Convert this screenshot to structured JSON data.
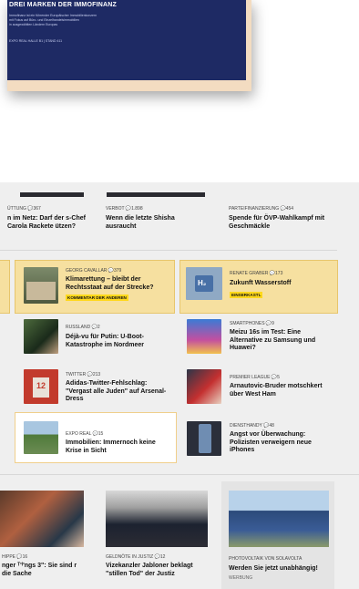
{
  "poster": {
    "title": "DREI MARKEN DER IMMOFINANZ",
    "line1": "Immofinanz ist ein führender Europäischer Immobilienkonzern",
    "line2": "mit Fokus auf Büro- und Einzelhandelsimmobilien",
    "line3": "in ausgewählten Ländern Europas",
    "stand": "EXPO REAL HALLE B1 | STAND 411"
  },
  "colors": {
    "accent_yellow": "#ffd81b",
    "card_yellow": "#f6e0a0",
    "poster_blue": "#1e2a64"
  },
  "row1": [
    {
      "meta": "ÜTTUNG 💬367",
      "headline": "n im Netz: Darf der s-Chef Carola Rackete ützen?"
    },
    {
      "meta": "VERBOT 💬1.898",
      "headline": "Wenn die letzte Shisha ausraucht"
    },
    {
      "meta": "PARTEIFINANZIERUNG 💬454",
      "headline": "Spende für ÖVP-Wahlkampf mit Geschmäckle"
    }
  ],
  "cards": [
    {
      "meta": "GEORG CAVALLAR 💬379",
      "headline": "Klimarettung – bleibt der Rechtsstaat auf der Strecke?",
      "tag": "KOMMENTAR DER ANDEREN"
    },
    {
      "meta": "RENATE GRABER 💬173",
      "headline": "Zukunft Wasserstoff",
      "tag": "EINSERKASTL",
      "icon_text": "H₂"
    }
  ],
  "list": [
    {
      "meta": "RUSSLAND 💬2",
      "headline": "Déjà-vu für Putin: U-Boot-Katastrophe im Nordmeer"
    },
    {
      "meta": "SMARTPHONES 💬9",
      "headline": "Meizu 16s im Test: Eine Alternative zu Samsung und Huawei?"
    },
    {
      "meta": "TWITTER 💬213",
      "headline": "Adidas-Twitter-Fehlschlag: \"Vergast alle Juden\" auf Arsenal-Dress",
      "jersey": "12"
    },
    {
      "meta": "PREMIER LEAGUE 💬5",
      "headline": "Arnautovic-Bruder motschkert über West Ham"
    },
    {
      "meta": "EXPO REAL 💬15",
      "headline": "Immobilien: Immernoch keine Krise in Sicht"
    },
    {
      "meta": "DIENSTHANDY 💬48",
      "headline": "Angst vor Überwachung: Polizisten verweigern neue iPhones"
    }
  ],
  "bottom": [
    {
      "meta": "HIPPE 💬16",
      "headline": "nger ᵀ'ᴵ'ngs 3\": Sie sind r die Sache"
    },
    {
      "meta": "GELDNÖTE IN JUSTIZ 💬12",
      "headline": "Vizekanzler Jabloner beklagt \"stillen Tod\" der Justiz"
    },
    {
      "meta": "PHOTOVOLTAIK VON SOLAVOLTA",
      "headline": "Werden Sie jetzt unabhängig!",
      "label": "WERBUNG"
    }
  ]
}
